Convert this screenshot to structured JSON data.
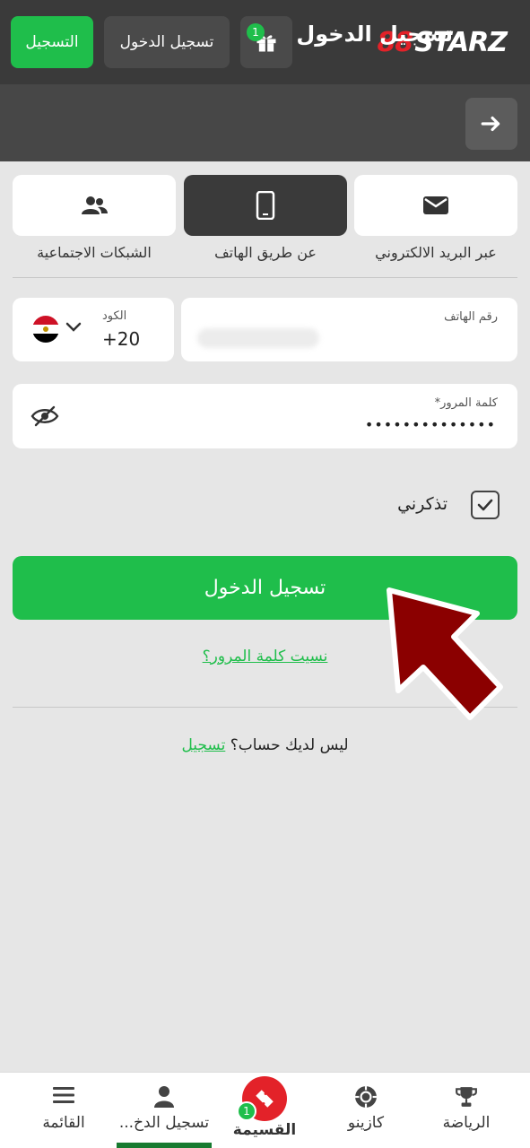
{
  "header": {
    "register_label": "التسجيل",
    "login_label": "تسجيل الدخول",
    "gift_badge": "1",
    "logo_mark": "88",
    "logo_word": "STARZ",
    "brand_color": "#1fbe4b",
    "logo_accent": "#e32229"
  },
  "titlebar": {
    "title": "تسجيل الدخول",
    "back_icon": "arrow-right-icon"
  },
  "tabs": [
    {
      "label": "عبر البريد الالكتروني",
      "icon": "envelope-icon",
      "active": false
    },
    {
      "label": "عن طريق الهاتف",
      "icon": "phone-icon",
      "active": true
    },
    {
      "label": "الشبكات الاجتماعية",
      "icon": "users-icon",
      "active": false
    }
  ],
  "phone_field": {
    "label": "رقم الهاتف",
    "value_hidden": true
  },
  "code_field": {
    "label": "الكود",
    "value": "+20",
    "country": "Egypt"
  },
  "password_field": {
    "label": "كلمة المرور*",
    "value": "••••••••••••••"
  },
  "remember": {
    "label": "تذكرني",
    "checked": true
  },
  "submit_label": "تسجيل الدخول",
  "forgot_label": "نسيت كلمة المرور؟",
  "no_account": {
    "text": "ليس لديك حساب؟",
    "link": "تسجيل"
  },
  "bottom_nav": [
    {
      "label": "الرياضة",
      "icon": "trophy-icon"
    },
    {
      "label": "كازينو",
      "icon": "casino-chip-icon"
    },
    {
      "label": "القسيمة",
      "icon": "ticket-icon",
      "badge": "1"
    },
    {
      "label": "تسجيل الدخ...",
      "icon": "user-icon",
      "active": true
    },
    {
      "label": "القائمة",
      "icon": "menu-icon"
    }
  ]
}
